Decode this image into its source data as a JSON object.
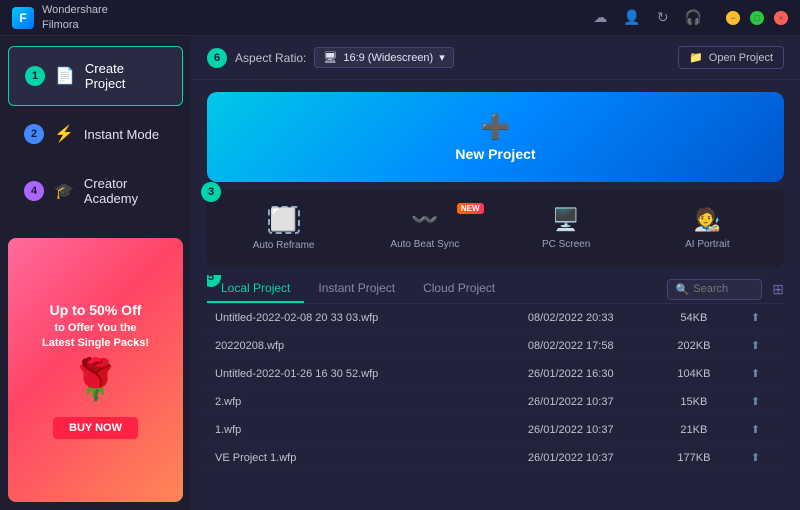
{
  "app": {
    "name_line1": "Wondershare",
    "name_line2": "Filmora"
  },
  "titlebar": {
    "controls": [
      "cloud-icon",
      "user-icon",
      "refresh-icon",
      "headphone-icon",
      "close-icon"
    ]
  },
  "sidebar": {
    "items": [
      {
        "num": "1",
        "icon": "📄",
        "label": "Create Project",
        "active": true
      },
      {
        "num": "2",
        "icon": "⚡",
        "label": "Instant Mode",
        "active": false
      },
      {
        "num": "4",
        "icon": "🎓",
        "label": "Creator Academy",
        "active": false
      }
    ],
    "ad": {
      "line1": "Up to 50% Off",
      "line2": "to Offer You the",
      "line3": "Latest Single Packs!",
      "button": "BUY NOW"
    }
  },
  "topbar": {
    "num": "6",
    "aspect_label": "Aspect Ratio:",
    "aspect_value": "16:9 (Widescreen)",
    "open_project": "Open Project"
  },
  "new_project": {
    "label": "New Project"
  },
  "tools": {
    "num": "3",
    "items": [
      {
        "icon": "⬛",
        "label": "Auto Reframe",
        "is_new": false
      },
      {
        "icon": "〰",
        "label": "Auto Beat Sync",
        "is_new": true
      },
      {
        "icon": "🖥",
        "label": "PC Screen",
        "is_new": false
      },
      {
        "icon": "👤",
        "label": "AI Portrait",
        "is_new": false
      }
    ]
  },
  "projects": {
    "num": "5",
    "tabs": [
      "Local Project",
      "Instant Project",
      "Cloud Project"
    ],
    "active_tab": 0,
    "search_placeholder": "Search",
    "rows": [
      {
        "name": "Untitled-2022-02-08 20 33 03.wfp",
        "date": "08/02/2022 20:33",
        "size": "54KB"
      },
      {
        "name": "20220208.wfp",
        "date": "08/02/2022 17:58",
        "size": "202KB"
      },
      {
        "name": "Untitled-2022-01-26 16 30 52.wfp",
        "date": "26/01/2022 16:30",
        "size": "104KB"
      },
      {
        "name": "2.wfp",
        "date": "26/01/2022 10:37",
        "size": "15KB"
      },
      {
        "name": "1.wfp",
        "date": "26/01/2022 10:37",
        "size": "21KB"
      },
      {
        "name": "VE Project 1.wfp",
        "date": "26/01/2022 10:37",
        "size": "177KB"
      }
    ]
  }
}
